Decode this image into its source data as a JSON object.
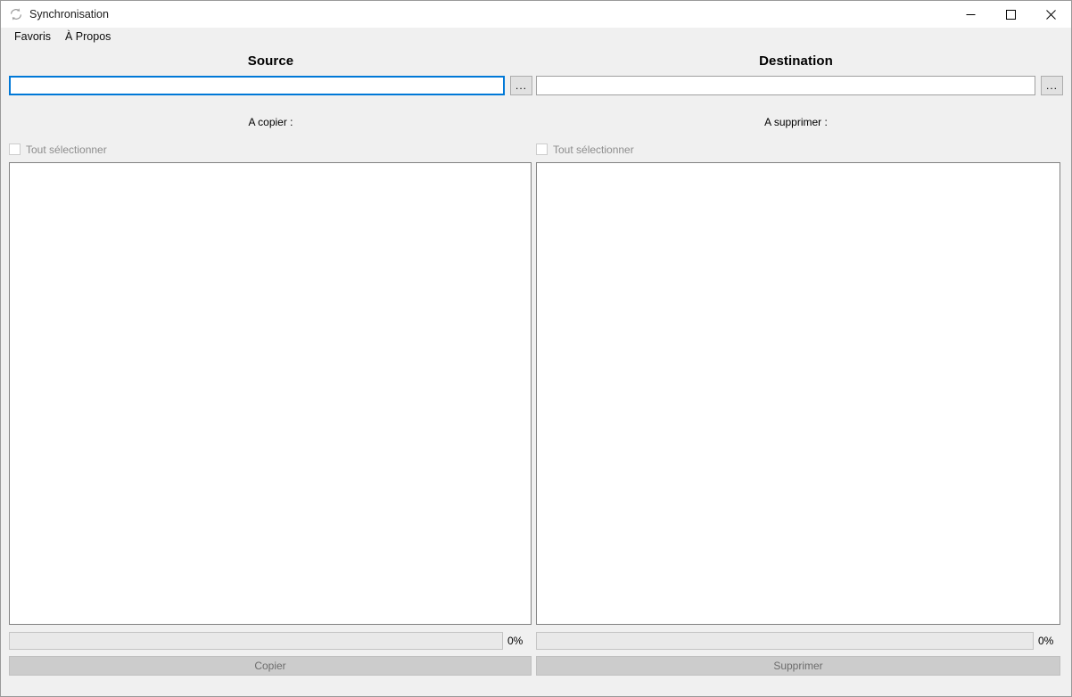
{
  "window": {
    "title": "Synchronisation",
    "icon": "sync-icon",
    "controls": {
      "minimize": "minimize-icon",
      "maximize": "maximize-icon",
      "close": "close-icon"
    }
  },
  "menubar": {
    "items": [
      {
        "label": "Favoris"
      },
      {
        "label": "À Propos"
      }
    ]
  },
  "source": {
    "title": "Source",
    "path_value": "",
    "path_placeholder": "",
    "browse_label": "...",
    "sub_label": "A copier :",
    "select_all_label": "Tout sélectionner",
    "select_all_checked": false,
    "list_items": [],
    "progress_percent": "0%",
    "progress_value": 0,
    "action_label": "Copier"
  },
  "destination": {
    "title": "Destination",
    "path_value": "",
    "path_placeholder": "",
    "browse_label": "...",
    "sub_label": "A supprimer :",
    "select_all_label": "Tout sélectionner",
    "select_all_checked": false,
    "list_items": [],
    "progress_percent": "0%",
    "progress_value": 0,
    "action_label": "Supprimer"
  },
  "colors": {
    "window_bg": "#f0f0f0",
    "titlebar_bg": "#ffffff",
    "focus_border": "#0078d7",
    "disabled_text": "#8d8d8d",
    "disabled_button_bg": "#cccccc",
    "list_border": "#828282"
  }
}
